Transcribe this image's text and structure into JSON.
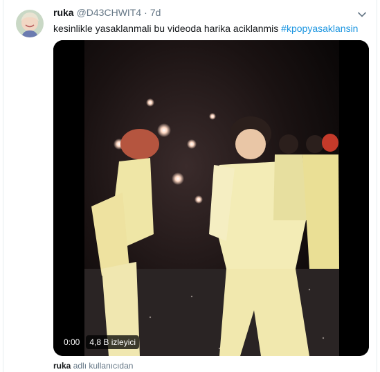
{
  "tweet": {
    "display_name": "ruka",
    "handle": "@D43CHWIT4",
    "dot": "·",
    "time": "7d",
    "text": "kesinlikle yasaklanmali bu videoda harika aciklanmis",
    "hashtag": "#kpopyasaklansin"
  },
  "video": {
    "timestamp": "0:00",
    "views": "4,8 B izleyici"
  },
  "footer": {
    "user": "ruka",
    "suffix": "adlı kullanıcıdan"
  },
  "icons": {
    "menu": "chevron-down-icon"
  },
  "colors": {
    "hashtag": "#1b95e0",
    "muted": "#657786",
    "text": "#14171a"
  }
}
